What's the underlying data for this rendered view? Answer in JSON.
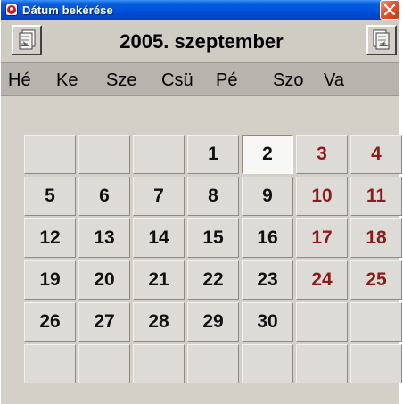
{
  "window": {
    "title": "Dátum bekérése",
    "close_label": "×"
  },
  "header": {
    "month_title": "2005. szeptember",
    "prev_icon": "calendar-prev-icon",
    "next_icon": "calendar-next-icon"
  },
  "weekdays": [
    "Hé",
    "Ke",
    "Sze",
    "Csü",
    "Pé",
    "Szo",
    "Va"
  ],
  "days": [
    [
      "",
      "",
      "",
      "1",
      "2",
      "3",
      "4"
    ],
    [
      "5",
      "6",
      "7",
      "8",
      "9",
      "10",
      "11"
    ],
    [
      "12",
      "13",
      "14",
      "15",
      "16",
      "17",
      "18"
    ],
    [
      "19",
      "20",
      "21",
      "22",
      "23",
      "24",
      "25"
    ],
    [
      "26",
      "27",
      "28",
      "29",
      "30",
      "",
      ""
    ],
    [
      "",
      "",
      "",
      "",
      "",
      "",
      ""
    ]
  ],
  "selected_day": "2",
  "colors": {
    "titlebar": "#0054e3",
    "weekend_text": "#8a1c1c",
    "panel": "#d4d0c8"
  }
}
